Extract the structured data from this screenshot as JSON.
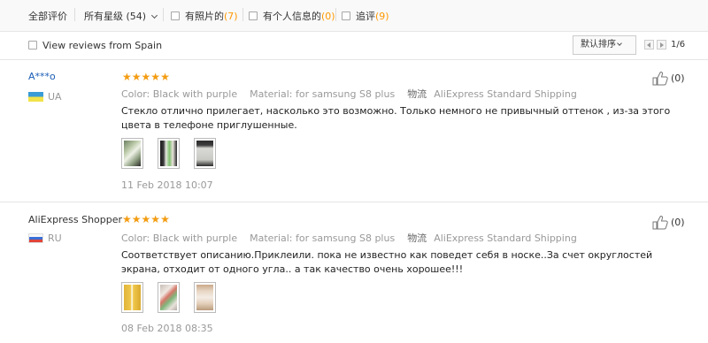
{
  "filters": {
    "all_reviews": "全部评价",
    "all_stars": "所有星级 (54)",
    "with_photos_label": "有照片的",
    "with_photos_count": "(7)",
    "personal_info_label": "有个人信息的",
    "personal_info_count": "(0)",
    "follow_up_label": "追评",
    "follow_up_count": "(9)"
  },
  "subbar": {
    "spain_label": "View reviews from Spain",
    "sort_label": "默认排序",
    "pagination": "1/6"
  },
  "reviews": [
    {
      "user": "A***o",
      "country": "UA",
      "stars": 5,
      "color": "Color: Black with purple",
      "material": "Material: for samsung S8 plus",
      "logistics_label": "物流",
      "shipping": "AliExpress Standard Shipping",
      "text": "Стекло отлично прилегает, насколько это возможно. Только немного не привычный оттенок , из-за этого цвета в телефоне приглушенные.",
      "date": "11 Feb 2018 10:07",
      "helpful": "(0)",
      "photos": 3
    },
    {
      "user": "AliExpress Shopper",
      "country": "RU",
      "stars": 5,
      "color": "Color: Black with purple",
      "material": "Material: for samsung S8 plus",
      "logistics_label": "物流",
      "shipping": "AliExpress Standard Shipping",
      "text": "Соответствует описанию.Приклеили. пока не известно как поведет себя в носке..За счет округлостей экрана, отходит от одного угла.. а так качество очень хорошее!!!",
      "date": "08 Feb 2018 08:35",
      "helpful": "(0)",
      "photos": 3
    }
  ],
  "colors": {
    "accent_orange": "#f39c12",
    "count_orange": "#ff9900",
    "username_blue": "#1a5db5",
    "muted_gray": "#999999"
  },
  "icons": [
    "checkbox-icon",
    "chevron-down-icon",
    "arrow-left-icon",
    "arrow-right-icon",
    "star-icon",
    "thumbs-up-icon",
    "flag-ua-icon",
    "flag-ru-icon"
  ]
}
